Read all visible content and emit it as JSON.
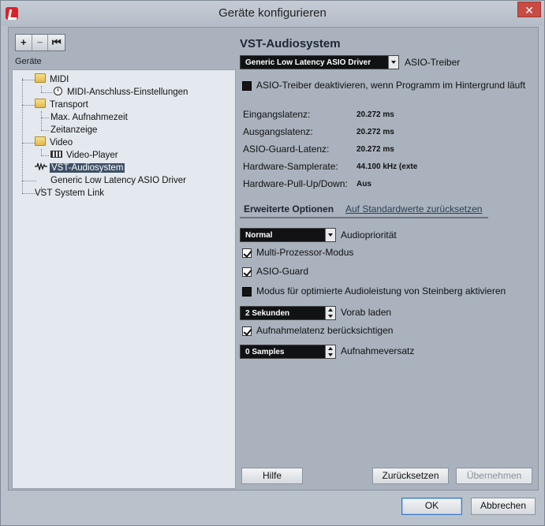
{
  "window": {
    "title": "Geräte konfigurieren",
    "close_label": "✕"
  },
  "toolbar": {
    "add": "+",
    "remove": "−",
    "reset": "⏮"
  },
  "tree": {
    "header": "Geräte",
    "items": [
      {
        "label": "MIDI"
      },
      {
        "label": "MIDI-Anschluss-Einstellungen"
      },
      {
        "label": "Transport"
      },
      {
        "label": "Max. Aufnahmezeit"
      },
      {
        "label": "Zeitanzeige"
      },
      {
        "label": "Video"
      },
      {
        "label": "Video-Player"
      },
      {
        "label": "VST-Audiosystem"
      },
      {
        "label": "Generic Low Latency ASIO Driver"
      },
      {
        "label": "VST System Link"
      }
    ]
  },
  "panel": {
    "title": "VST-Audiosystem",
    "driver_select": "Generic Low Latency ASIO Driver",
    "driver_label": "ASIO-Treiber",
    "deactivate_label": "ASIO-Treiber deaktivieren, wenn Programm im Hintergrund läuft",
    "info": [
      {
        "label": "Eingangslatenz:",
        "value": "20.272 ms"
      },
      {
        "label": "Ausgangslatenz:",
        "value": "20.272 ms"
      },
      {
        "label": "ASIO-Guard-Latenz:",
        "value": "20.272 ms"
      },
      {
        "label": "Hardware-Samplerate:",
        "value": "44.100 kHz (exte"
      },
      {
        "label": "Hardware-Pull-Up/Down:",
        "value": "Aus"
      }
    ],
    "tabs": {
      "advanced": "Erweiterte Optionen",
      "reset_defaults": "Auf Standardwerte zurücksetzen"
    },
    "priority_select": "Normal",
    "priority_label": "Audiopriorität",
    "multiprocessor_label": "Multi-Prozessor-Modus",
    "asio_guard_label": "ASIO-Guard",
    "steinberg_label": "Modus für optimierte Audioleistung von Steinberg aktivieren",
    "preload_value": "2 Sekunden",
    "preload_label": "Vorab laden",
    "latency_label": "Aufnahmelatenz berücksichtigen",
    "offset_value": "0 Samples",
    "offset_label": "Aufnahmeversatz",
    "checkboxes": {
      "deactivate": false,
      "multiprocessor": true,
      "asio_guard": true,
      "steinberg": false,
      "latency": true
    }
  },
  "buttons": {
    "help": "Hilfe",
    "reset": "Zurücksetzen",
    "apply": "Übernehmen",
    "ok": "OK",
    "cancel": "Abbrechen"
  }
}
